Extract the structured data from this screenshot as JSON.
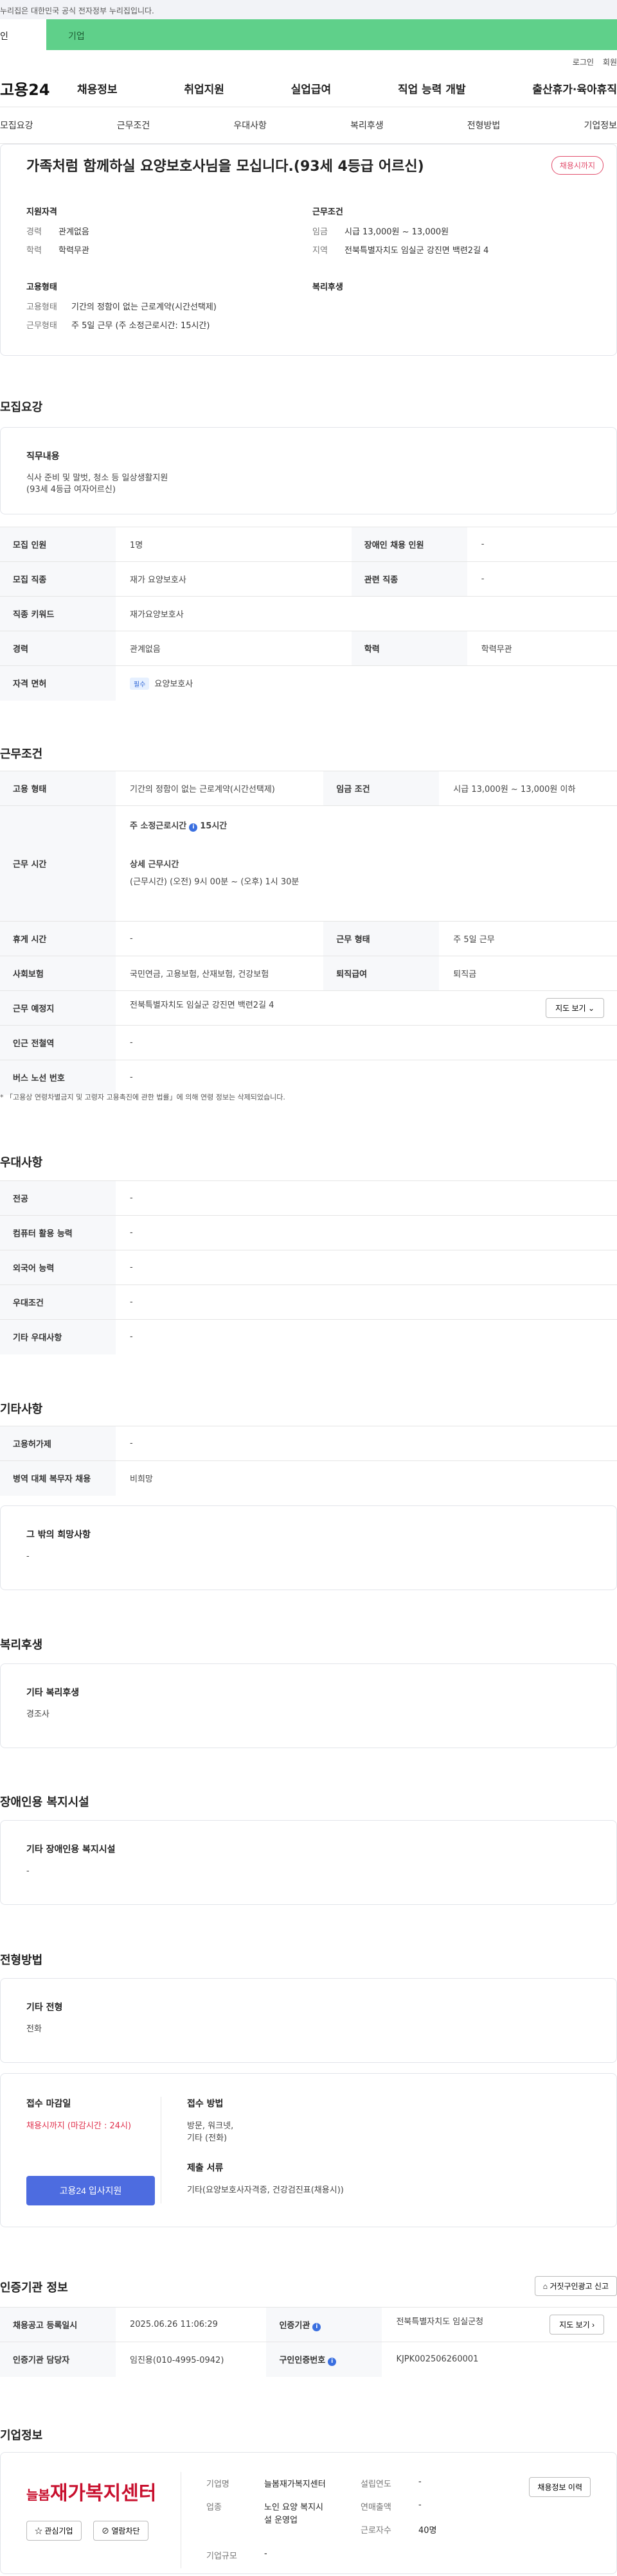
{
  "gov_notice": "누리집은 대한민국 공식 전자정부 누리집입니다.",
  "tab_personal": "인",
  "tab_company": "기업",
  "util": {
    "login": "로그인",
    "join": "회원"
  },
  "logo": "고용24",
  "gnb": [
    "채용정보",
    "취업지원",
    "실업급여",
    "직업 능력 개발",
    "출산휴가·육아휴직"
  ],
  "subnav": [
    "모집요강",
    "근무조건",
    "우대사항",
    "복리후생",
    "전형방법",
    "기업정보"
  ],
  "summary": {
    "title": "가족처럼 함께하실 요양보호사님을 모십니다.(93세 4등급 어르신)",
    "badge": "채용시까지",
    "qual_title": "지원자격",
    "qual": [
      {
        "k": "경력",
        "v": "관계없음"
      },
      {
        "k": "학력",
        "v": "학력무관"
      }
    ],
    "cond_title": "근무조건",
    "cond": [
      {
        "k": "임금",
        "v": "시급 13,000원 ~ 13,000원"
      },
      {
        "k": "지역",
        "v": "전북특별자치도 임실군 강진면 백련2길 4"
      }
    ],
    "emp_title": "고용형태",
    "emp": [
      {
        "k": "고용형태",
        "v": "기간의 정함이 없는 근로계약(시간선택제)"
      },
      {
        "k": "근무형태",
        "v": "주 5일 근무 (주 소정근로시간: 15시간)"
      }
    ],
    "welfare_title": "복리후생"
  },
  "recruit": {
    "title": "모집요강",
    "job_title": "직무내용",
    "job_line1": "식사 준비 및 말벗, 청소 등 일상생활지원",
    "job_line2": "(93세 4등급 여자어르신)",
    "rows": {
      "people_k": "모집 인원",
      "people_v": "1명",
      "disabled_k": "장애인 채용 인원",
      "disabled_v": "-",
      "job_k": "모집 직종",
      "job_v": "재가 요양보호사",
      "related_k": "관련 직종",
      "related_v": "-",
      "keyword_k": "직종 키워드",
      "keyword_v": "재가요양보호사",
      "career_k": "경력",
      "career_v": "관계없음",
      "edu_k": "학력",
      "edu_v": "학력무관",
      "license_k": "자격 면허",
      "license_tag": "필수",
      "license_v": "요양보호사"
    }
  },
  "work": {
    "title": "근무조건",
    "emp_k": "고용 형태",
    "emp_v": "기간의 정함이 없는 근로계약(시간선택제)",
    "wage_k": "임금 조건",
    "wage_v": "시급 13,000원 ~ 13,000원 이하",
    "time_k": "근무 시간",
    "time_weekly": "주 소정근로시간",
    "time_weekly_v": "15시간",
    "time_detail_title": "상세 근무시간",
    "time_detail": "(근무시간) (오전) 9시 00분 ~ (오후) 1시 30분",
    "rest_k": "휴게 시간",
    "rest_v": "-",
    "type_k": "근무 형태",
    "type_v": "주 5일 근무",
    "insurance_k": "사회보험",
    "insurance_v": "국민연금, 고용보험, 산재보험, 건강보험",
    "retire_k": "퇴직급여",
    "retire_v": "퇴직금",
    "place_k": "근무 예정지",
    "place_v": "전북특별자치도 임실군 강진면 백련2길 4",
    "map_btn": "지도 보기",
    "station_k": "인근 전철역",
    "station_v": "-",
    "bus_k": "버스 노선 번호",
    "bus_v": "-",
    "note": "* 「고용상 연령차별금지 및 고령자 고용촉진에 관한 법률」에 의해 연령 정보는 삭제되었습니다."
  },
  "pref": {
    "title": "우대사항",
    "rows": [
      {
        "k": "전공",
        "v": "-"
      },
      {
        "k": "컴퓨터 활용 능력",
        "v": "-"
      },
      {
        "k": "외국어 능력",
        "v": "-"
      },
      {
        "k": "우대조건",
        "v": "-"
      },
      {
        "k": "기타 우대사항",
        "v": "-"
      }
    ]
  },
  "etc": {
    "title": "기타사항",
    "rows": [
      {
        "k": "고용허가제",
        "v": "-"
      },
      {
        "k": "병역 대체 복무자 채용",
        "v": "비희망"
      }
    ],
    "hope_title": "그 밖의 희망사항",
    "hope_v": "-"
  },
  "welfare": {
    "title": "복리후생",
    "box_title": "기타 복리후생",
    "box_v": "경조사"
  },
  "disabled": {
    "title": "장애인용 복지시설",
    "box_title": "기타 장애인용 복지시설",
    "box_v": "-"
  },
  "process": {
    "title": "전형방법",
    "box_title": "기타 전형",
    "box_v": "전화"
  },
  "apply": {
    "deadline_title": "접수 마감일",
    "deadline_v": "채용시까지 (마감시간 : 24시)",
    "apply_btn": "고용24 입사지원",
    "method_title": "접수 방법",
    "method_v1": "방문, 워크넷,",
    "method_v2": "기타 (전화)",
    "docs_title": "제출 서류",
    "docs_v": "기타(요양보호사자격증, 건강검진표(채용시))"
  },
  "cert": {
    "title": "인증기관 정보",
    "report_btn": "거짓구인광고 신고",
    "reg_k": "채용공고 등록일시",
    "reg_v": "2025.06.26 11:06:29",
    "agency_k": "인증기관",
    "agency_v": "전북특별자치도 임실군청",
    "map_btn": "지도 보기",
    "manager_k": "인증기관 담당자",
    "manager_v": "임진용(010-4995-0942)",
    "cert_k": "구인인증번호",
    "cert_v": "KJPK002506260001"
  },
  "company": {
    "title": "기업정보",
    "logo_prefix": "늘봄",
    "logo_name": "재가복지센터",
    "fav_btn": "관심기업",
    "block_btn": "열람차단",
    "name_k": "기업명",
    "name_v": "늘봄재가복지센터",
    "year_k": "설립연도",
    "year_v": "-",
    "industry_k": "업종",
    "industry_v1": "노인 요양 복지시",
    "industry_v2": "설 운영업",
    "sales_k": "연매출액",
    "sales_v": "-",
    "staff_k": "근로자수",
    "staff_v": "40명",
    "size_k": "기업규모",
    "size_v": "-",
    "history_btn": "채용정보 이력"
  },
  "colors": {
    "accent": "#4d6ce0",
    "tab_green": "#5fd08a",
    "badge_red": "#e24d6c"
  }
}
